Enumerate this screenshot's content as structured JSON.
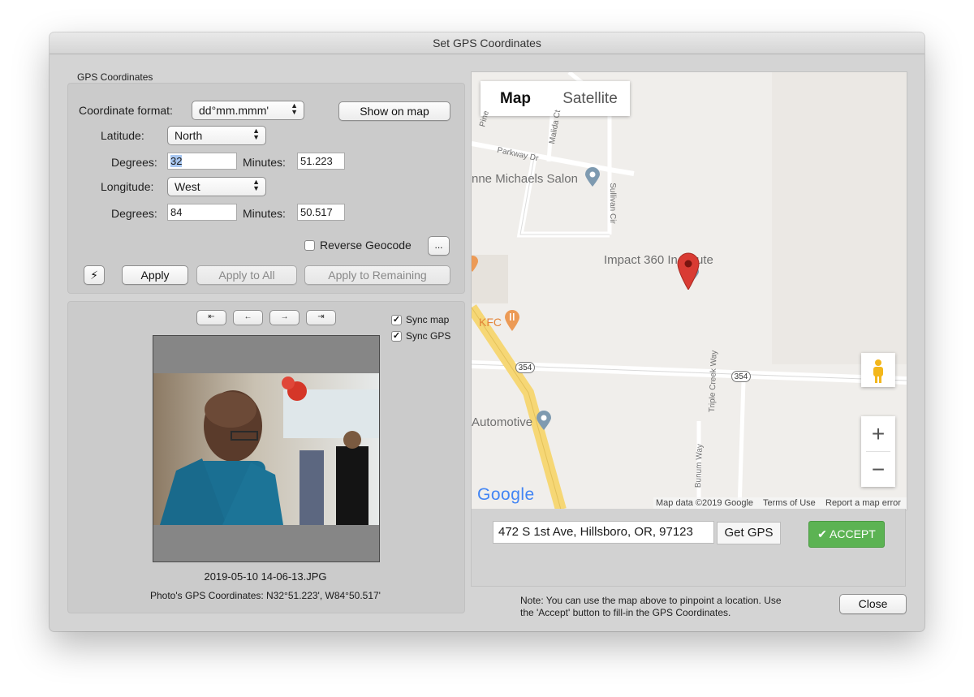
{
  "window": {
    "title": "Set GPS Coordinates"
  },
  "gps": {
    "group_label": "GPS Coordinates",
    "coord_format_label": "Coordinate format:",
    "coord_format_value": "dd°mm.mmm'",
    "show_on_map": "Show on map",
    "latitude_label": "Latitude:",
    "latitude_value": "North",
    "lat_degrees_label": "Degrees:",
    "lat_degrees_value": "32",
    "lat_minutes_label": "Minutes:",
    "lat_minutes_value": "51.223",
    "longitude_label": "Longitude:",
    "longitude_value": "West",
    "lon_degrees_label": "Degrees:",
    "lon_degrees_value": "84",
    "lon_minutes_label": "Minutes:",
    "lon_minutes_value": "50.517",
    "reverse_geocode": "Reverse Geocode",
    "more_button": "...",
    "apply": "Apply",
    "apply_all": "Apply to All",
    "apply_remaining": "Apply to Remaining"
  },
  "photo": {
    "nav": [
      "⇤",
      "←",
      "→",
      "⇥"
    ],
    "sync_map": "Sync map",
    "sync_gps": "Sync GPS",
    "filename": "2019-05-10 14-06-13.JPG",
    "coords_text": "Photo's GPS Coordinates: N32°51.223', W84°50.517'"
  },
  "map": {
    "tab_map": "Map",
    "tab_satellite": "Satellite",
    "pine": "Pine",
    "parkway": "Parkway Dr",
    "malida": "Malida Ct",
    "salon": "nne Michaels Salon",
    "sullivan": "Sullivan Cir",
    "impact": "Impact 360 In",
    "impact_tail": "ute",
    "kfc": "KFC",
    "route_a": "354",
    "route_b": "354",
    "automotive": "Automotive",
    "triple_creek": "Triple Creek Way",
    "bunum": "Bunum Way",
    "zoom_in": "+",
    "zoom_out": "−",
    "logo": "Google",
    "attribution": "Map data ©2019 Google",
    "terms": "Terms of Use",
    "report": "Report a map error"
  },
  "address": {
    "value": "472 S 1st Ave, Hillsboro, OR, 97123",
    "get_gps": "Get GPS",
    "accept": "✔ ACCEPT"
  },
  "note": {
    "line1": "Note: You can use the map above to pinpoint a location.  Use",
    "line2": "the 'Accept' button to fill-in the GPS Coordinates.",
    "close": "Close"
  },
  "colors": {
    "accept_green": "#5cb353",
    "pin_red": "#d93b33",
    "poi_blue": "#7e9ab0",
    "kfc_orange": "#ec9a55",
    "highway_yellow": "#f6d775"
  }
}
